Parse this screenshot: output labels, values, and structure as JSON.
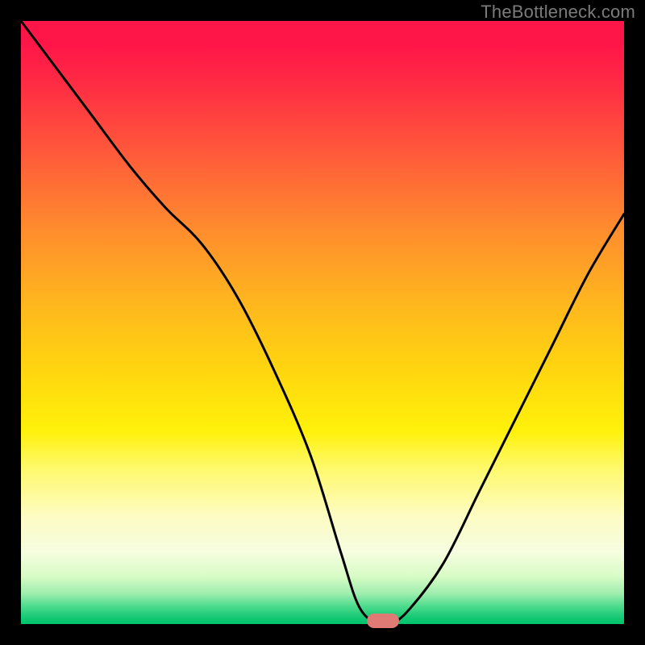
{
  "watermark": "TheBottleneck.com",
  "colors": {
    "curve_stroke": "#000000",
    "indicator_fill": "#df7b74",
    "frame_bg": "#000000"
  },
  "chart_data": {
    "type": "line",
    "title": "",
    "xlabel": "",
    "ylabel": "",
    "xlim": [
      0,
      100
    ],
    "ylim": [
      0,
      100
    ],
    "note": "No axis ticks or labels shown. Y runs top(100)->bottom(0). Curve is a V-shaped bottleneck profile; values estimated from pixel positions.",
    "series": [
      {
        "name": "bottleneck-curve",
        "x": [
          0,
          6,
          12,
          18,
          24,
          30,
          36,
          42,
          48,
          53,
          56,
          59,
          61,
          64,
          70,
          76,
          82,
          88,
          94,
          100
        ],
        "y": [
          100,
          92,
          84,
          76,
          69,
          63,
          54,
          42,
          28,
          12,
          3,
          0,
          0,
          2,
          10,
          22,
          34,
          46,
          58,
          68
        ]
      }
    ],
    "indicator": {
      "x": 60,
      "y": 0
    },
    "gradient_stops": [
      {
        "pct": 0,
        "color": "#ff1648"
      },
      {
        "pct": 50,
        "color": "#ffd60f"
      },
      {
        "pct": 85,
        "color": "#fdfcc2"
      },
      {
        "pct": 100,
        "color": "#00c36b"
      }
    ]
  }
}
